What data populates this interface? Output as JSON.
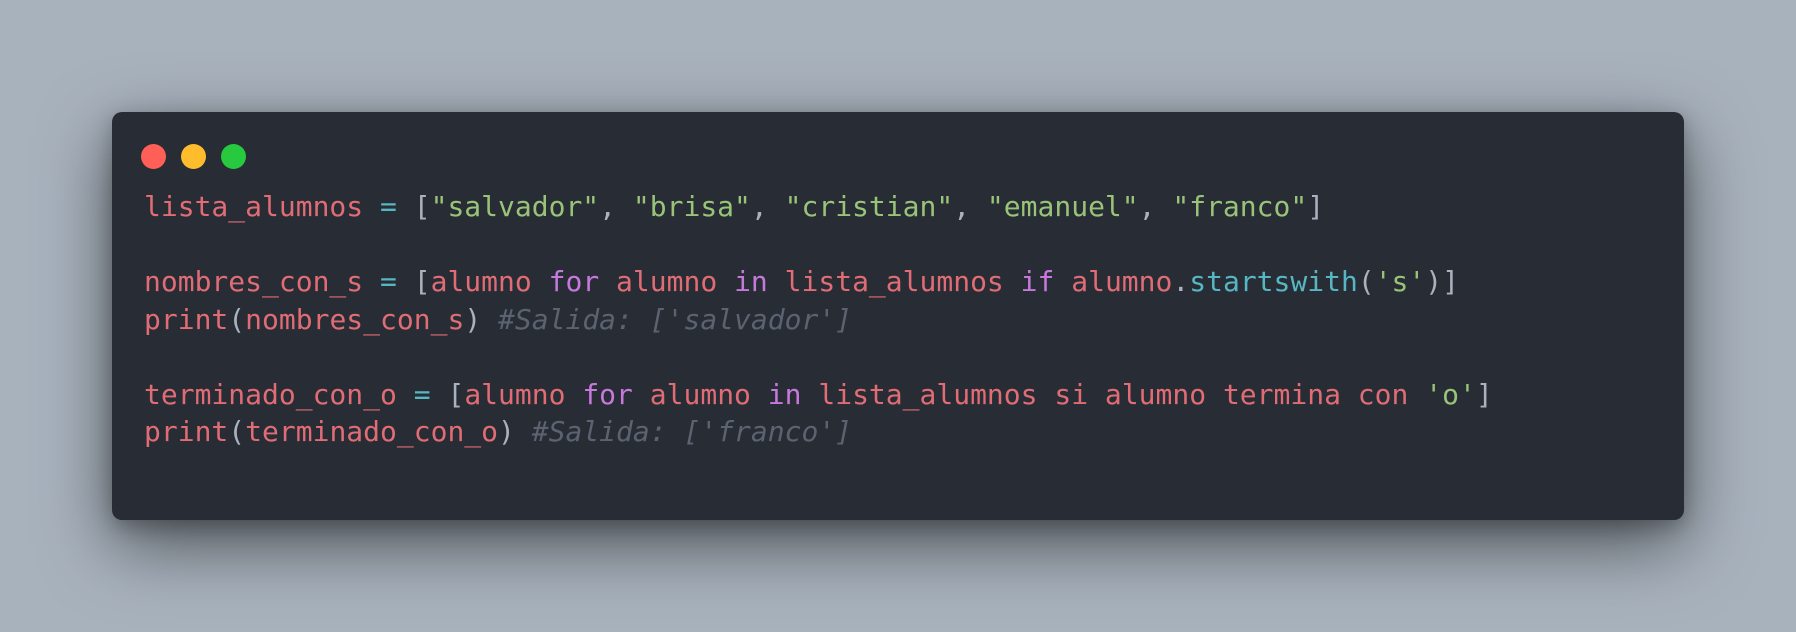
{
  "colors": {
    "background": "#a8b2bd",
    "window": "#282c34",
    "close": "#ff5f56",
    "minimize": "#ffbd2e",
    "maximize": "#27c93f",
    "variable": "#e06c75",
    "operator": "#56b6c2",
    "punctuation": "#abb2bf",
    "string": "#98c379",
    "keyword": "#c678dd",
    "function": "#56b6c2",
    "comment": "#5c6370"
  },
  "window_controls": [
    "close-dot",
    "minimize-dot",
    "maximize-dot"
  ],
  "code": {
    "lines": [
      {
        "tokens": [
          {
            "t": "lista_alumnos",
            "c": "v"
          },
          {
            "t": " ",
            "c": "p"
          },
          {
            "t": "=",
            "c": "op"
          },
          {
            "t": " ",
            "c": "p"
          },
          {
            "t": "[",
            "c": "p"
          },
          {
            "t": "\"salvador\"",
            "c": "s"
          },
          {
            "t": ", ",
            "c": "p"
          },
          {
            "t": "\"brisa\"",
            "c": "s"
          },
          {
            "t": ", ",
            "c": "p"
          },
          {
            "t": "\"cristian\"",
            "c": "s"
          },
          {
            "t": ", ",
            "c": "p"
          },
          {
            "t": "\"emanuel\"",
            "c": "s"
          },
          {
            "t": ", ",
            "c": "p"
          },
          {
            "t": "\"franco\"",
            "c": "s"
          },
          {
            "t": "]",
            "c": "p"
          }
        ]
      },
      {
        "tokens": []
      },
      {
        "tokens": [
          {
            "t": "nombres_con_s",
            "c": "v"
          },
          {
            "t": " ",
            "c": "p"
          },
          {
            "t": "=",
            "c": "op"
          },
          {
            "t": " ",
            "c": "p"
          },
          {
            "t": "[",
            "c": "p"
          },
          {
            "t": "alumno",
            "c": "v"
          },
          {
            "t": " ",
            "c": "p"
          },
          {
            "t": "for",
            "c": "k"
          },
          {
            "t": " ",
            "c": "p"
          },
          {
            "t": "alumno",
            "c": "v"
          },
          {
            "t": " ",
            "c": "p"
          },
          {
            "t": "in",
            "c": "k"
          },
          {
            "t": " ",
            "c": "p"
          },
          {
            "t": "lista_alumnos",
            "c": "v"
          },
          {
            "t": " ",
            "c": "p"
          },
          {
            "t": "if",
            "c": "k"
          },
          {
            "t": " ",
            "c": "p"
          },
          {
            "t": "alumno",
            "c": "v"
          },
          {
            "t": ".",
            "c": "p"
          },
          {
            "t": "startswith",
            "c": "f"
          },
          {
            "t": "(",
            "c": "p"
          },
          {
            "t": "'s'",
            "c": "s"
          },
          {
            "t": ")]",
            "c": "p"
          }
        ]
      },
      {
        "tokens": [
          {
            "t": "print",
            "c": "v"
          },
          {
            "t": "(",
            "c": "p"
          },
          {
            "t": "nombres_con_s",
            "c": "v"
          },
          {
            "t": ") ",
            "c": "p"
          },
          {
            "t": "#Salida: ['salvador']",
            "c": "c"
          }
        ]
      },
      {
        "tokens": []
      },
      {
        "tokens": [
          {
            "t": "terminado_con_o",
            "c": "v"
          },
          {
            "t": " ",
            "c": "p"
          },
          {
            "t": "=",
            "c": "op"
          },
          {
            "t": " ",
            "c": "p"
          },
          {
            "t": "[",
            "c": "p"
          },
          {
            "t": "alumno",
            "c": "v"
          },
          {
            "t": " ",
            "c": "p"
          },
          {
            "t": "for",
            "c": "k"
          },
          {
            "t": " ",
            "c": "p"
          },
          {
            "t": "alumno",
            "c": "v"
          },
          {
            "t": " ",
            "c": "p"
          },
          {
            "t": "in",
            "c": "k"
          },
          {
            "t": " ",
            "c": "p"
          },
          {
            "t": "lista_alumnos si alumno termina con",
            "c": "v"
          },
          {
            "t": " ",
            "c": "p"
          },
          {
            "t": "'o'",
            "c": "s"
          },
          {
            "t": "]",
            "c": "p"
          }
        ]
      },
      {
        "tokens": [
          {
            "t": "print",
            "c": "v"
          },
          {
            "t": "(",
            "c": "p"
          },
          {
            "t": "terminado_con_o",
            "c": "v"
          },
          {
            "t": ") ",
            "c": "p"
          },
          {
            "t": "#Salida: ['franco']",
            "c": "c"
          }
        ]
      }
    ]
  }
}
